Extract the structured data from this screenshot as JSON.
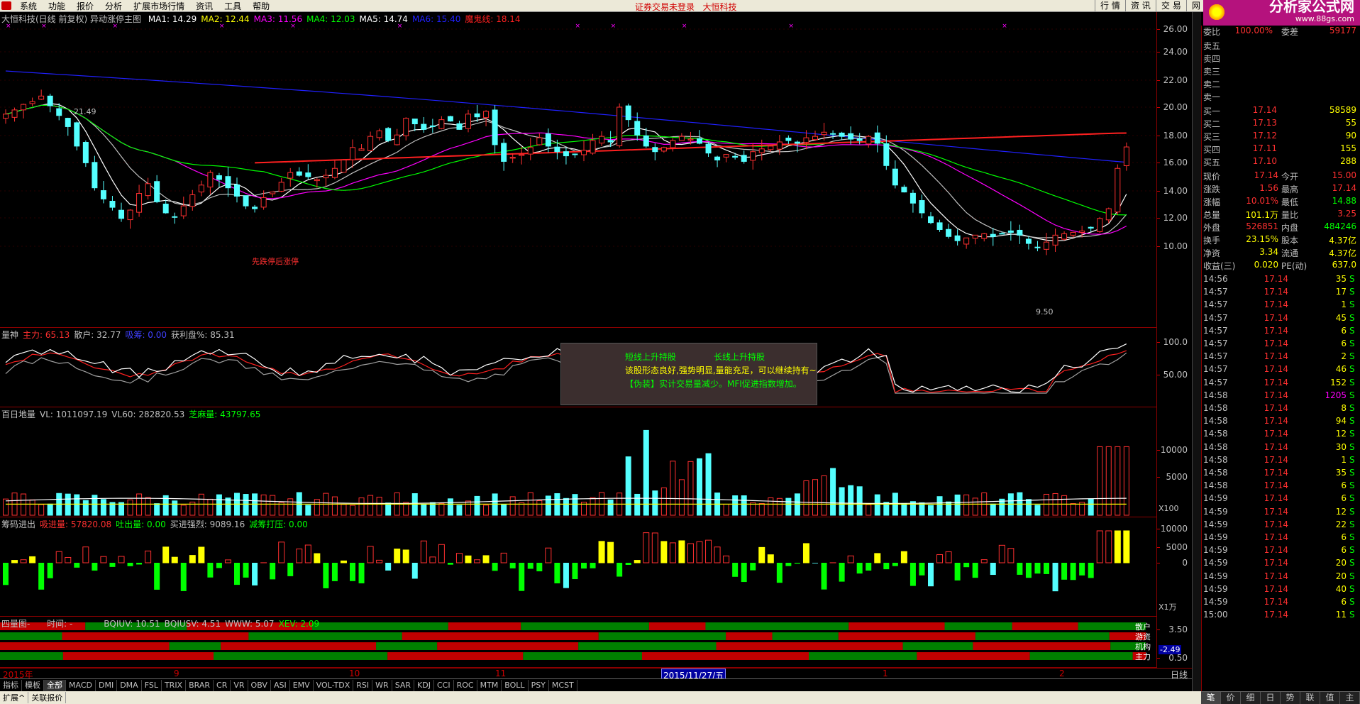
{
  "menubar": {
    "items": [
      "系统",
      "功能",
      "报价",
      "分析",
      "扩展市场行情",
      "资讯",
      "工具",
      "帮助"
    ],
    "notice": "证券交易未登录",
    "notice_name": "大恒科技",
    "right": [
      "行 情",
      "资 讯",
      "交 易",
      "网 上"
    ],
    "brand": "分析家公式网",
    "brand_url": "www.88gs.com"
  },
  "main": {
    "title": "大恒科技(日线 前复权) 异动涨停主图",
    "ma": [
      {
        "label": "MA1: 14.29",
        "color": "#ffffff"
      },
      {
        "label": "MA2: 12.44",
        "color": "#ffff00"
      },
      {
        "label": "MA3: 11.56",
        "color": "#ff00ff"
      },
      {
        "label": "MA4: 12.03",
        "color": "#00ff00"
      },
      {
        "label": "MA5: 14.74",
        "color": "#ffffff"
      },
      {
        "label": "MA6: 15.40",
        "color": "#2020ff"
      },
      {
        "label": "魔鬼线: 18.14",
        "color": "#ff2020"
      }
    ],
    "yticks": [
      "26.00",
      "24.00",
      "22.00",
      "20.00",
      "18.00",
      "16.00",
      "14.00",
      "12.00",
      "10.00"
    ],
    "hi_label": "21.49",
    "lo_label": "9.50",
    "note": "先跌停后涨停"
  },
  "ind1": {
    "title": "量神",
    "items": [
      {
        "label": "主力: 65.13",
        "color": "#ff3030"
      },
      {
        "label": "散户: 32.77",
        "color": "#c0c0c0"
      },
      {
        "label": "吸筹: 0.00",
        "color": "#4040ff"
      },
      {
        "label": "获利盘%: 85.31",
        "color": "#c0c0c0"
      }
    ],
    "yticks": [
      "100.0",
      "50.00"
    ]
  },
  "ind2": {
    "title": "百日地量",
    "items": [
      {
        "label": "VL: 1011097.19",
        "color": "#c0c0c0"
      },
      {
        "label": "VL60: 282820.53",
        "color": "#c0c0c0"
      },
      {
        "label": "芝麻量: 43797.65",
        "color": "#00ff00"
      }
    ],
    "yticks": [
      "10000",
      "5000"
    ],
    "unit": "X100"
  },
  "ind3": {
    "title": "筹码进出",
    "items": [
      {
        "label": "吸进量: 57820.08",
        "color": "#ff3030"
      },
      {
        "label": "吐出量: 0.00",
        "color": "#00ff00"
      },
      {
        "label": "买进强烈: 9089.16",
        "color": "#c0c0c0"
      },
      {
        "label": "减筹打压: 0.00",
        "color": "#00ff00"
      }
    ],
    "yticks": [
      "10000",
      "5000",
      "0"
    ],
    "unit": "X1万"
  },
  "ind4": {
    "title": "四量图-",
    "time": "时间: -",
    "items": [
      {
        "label": "BQIUV: 10.51",
        "color": "#c0c0c0"
      },
      {
        "label": "BQIUSV: 4.51",
        "color": "#c0c0c0"
      },
      {
        "label": "WWW: 5.07",
        "color": "#c0c0c0"
      },
      {
        "label": "XEV: 2.09",
        "color": "#00ff00"
      }
    ],
    "rows": [
      "散户",
      "游资",
      "机构",
      "主力"
    ],
    "yticks": [
      "3.50",
      "0.50"
    ],
    "cur": "-2.49"
  },
  "tooltip": {
    "l1a": "短线上升持股",
    "l1b": "长线上升持股",
    "l2": "该股形态良好,强势明显,量能充足，可以继续持有~",
    "l3": "【伪装】实计交易量减少。MFI促进指数增加。"
  },
  "xaxis": {
    "labels": [
      "2015年",
      "9",
      "10",
      "11",
      "1",
      "2"
    ],
    "highlight": "2015/11/27/五",
    "period": "日线"
  },
  "tabs": [
    "指标",
    "模板",
    "全部",
    "MACD",
    "DMI",
    "DMA",
    "FSL",
    "TRIX",
    "BRAR",
    "CR",
    "VR",
    "OBV",
    "ASI",
    "EMV",
    "VOL-TDX",
    "RSI",
    "WR",
    "SAR",
    "KDJ",
    "CCI",
    "ROC",
    "MTM",
    "BOLL",
    "PSY",
    "MCST"
  ],
  "status": [
    "扩展^",
    "关联报价"
  ],
  "quote": {
    "weibi": {
      "l1": "委比",
      "v1": "100.00%",
      "l2": "委差",
      "v2": "59177"
    },
    "sell": [
      {
        "l": "卖五",
        "p": "",
        "v": ""
      },
      {
        "l": "卖四",
        "p": "",
        "v": ""
      },
      {
        "l": "卖三",
        "p": "",
        "v": ""
      },
      {
        "l": "卖二",
        "p": "",
        "v": ""
      },
      {
        "l": "卖一",
        "p": "",
        "v": ""
      }
    ],
    "buy": [
      {
        "l": "买一",
        "p": "17.14",
        "v": "58589"
      },
      {
        "l": "买二",
        "p": "17.13",
        "v": "55"
      },
      {
        "l": "买三",
        "p": "17.12",
        "v": "90"
      },
      {
        "l": "买四",
        "p": "17.11",
        "v": "155"
      },
      {
        "l": "买五",
        "p": "17.10",
        "v": "288"
      }
    ],
    "stats": [
      {
        "l1": "现价",
        "v1": "17.14",
        "c1": "#ff3030",
        "l2": "今开",
        "v2": "15.00",
        "c2": "#ff3030"
      },
      {
        "l1": "涨跌",
        "v1": "1.56",
        "c1": "#ff3030",
        "l2": "最高",
        "v2": "17.14",
        "c2": "#ff3030"
      },
      {
        "l1": "涨幅",
        "v1": "10.01%",
        "c1": "#ff3030",
        "l2": "最低",
        "v2": "14.88",
        "c2": "#00ff00"
      },
      {
        "l1": "总量",
        "v1": "101.1万",
        "c1": "#ffff00",
        "l2": "量比",
        "v2": "3.25",
        "c2": "#ff3030"
      },
      {
        "l1": "外盘",
        "v1": "526851",
        "c1": "#ff3030",
        "l2": "内盘",
        "v2": "484246",
        "c2": "#00ff00"
      },
      {
        "l1": "换手",
        "v1": "23.15%",
        "c1": "#ffff00",
        "l2": "股本",
        "v2": "4.37亿",
        "c2": "#ffff00"
      },
      {
        "l1": "净资",
        "v1": "3.34",
        "c1": "#ffff00",
        "l2": "流通",
        "v2": "4.37亿",
        "c2": "#ffff00"
      },
      {
        "l1": "收益(三)",
        "v1": "0.020",
        "c1": "#ffff00",
        "l2": "PE(动)",
        "v2": "637.0",
        "c2": "#ffff00"
      }
    ],
    "ticks": [
      {
        "t": "14:56",
        "p": "17.14",
        "v": "35",
        "d": "S"
      },
      {
        "t": "14:57",
        "p": "17.14",
        "v": "17",
        "d": "S"
      },
      {
        "t": "14:57",
        "p": "17.14",
        "v": "1",
        "d": "S"
      },
      {
        "t": "14:57",
        "p": "17.14",
        "v": "45",
        "d": "S"
      },
      {
        "t": "14:57",
        "p": "17.14",
        "v": "6",
        "d": "S"
      },
      {
        "t": "14:57",
        "p": "17.14",
        "v": "6",
        "d": "S"
      },
      {
        "t": "14:57",
        "p": "17.14",
        "v": "2",
        "d": "S"
      },
      {
        "t": "14:57",
        "p": "17.14",
        "v": "46",
        "d": "S"
      },
      {
        "t": "14:57",
        "p": "17.14",
        "v": "152",
        "d": "S"
      },
      {
        "t": "14:58",
        "p": "17.14",
        "v": "1205",
        "d": "S"
      },
      {
        "t": "14:58",
        "p": "17.14",
        "v": "8",
        "d": "S"
      },
      {
        "t": "14:58",
        "p": "17.14",
        "v": "94",
        "d": "S"
      },
      {
        "t": "14:58",
        "p": "17.14",
        "v": "12",
        "d": "S"
      },
      {
        "t": "14:58",
        "p": "17.14",
        "v": "30",
        "d": "S"
      },
      {
        "t": "14:58",
        "p": "17.14",
        "v": "1",
        "d": "S"
      },
      {
        "t": "14:58",
        "p": "17.14",
        "v": "35",
        "d": "S"
      },
      {
        "t": "14:58",
        "p": "17.14",
        "v": "6",
        "d": "S"
      },
      {
        "t": "14:59",
        "p": "17.14",
        "v": "6",
        "d": "S"
      },
      {
        "t": "14:59",
        "p": "17.14",
        "v": "12",
        "d": "S"
      },
      {
        "t": "14:59",
        "p": "17.14",
        "v": "22",
        "d": "S"
      },
      {
        "t": "14:59",
        "p": "17.14",
        "v": "6",
        "d": "S"
      },
      {
        "t": "14:59",
        "p": "17.14",
        "v": "6",
        "d": "S"
      },
      {
        "t": "14:59",
        "p": "17.14",
        "v": "20",
        "d": "S"
      },
      {
        "t": "14:59",
        "p": "17.14",
        "v": "20",
        "d": "S"
      },
      {
        "t": "14:59",
        "p": "17.14",
        "v": "40",
        "d": "S"
      },
      {
        "t": "14:59",
        "p": "17.14",
        "v": "6",
        "d": "S"
      },
      {
        "t": "15:00",
        "p": "17.14",
        "v": "11",
        "d": "S"
      }
    ],
    "tabs": [
      "笔",
      "价",
      "细",
      "日",
      "势",
      "联",
      "值",
      "主"
    ]
  },
  "colors": {
    "up": "#ff3030",
    "down": "#54ffff",
    "grid": "#8b0000"
  }
}
